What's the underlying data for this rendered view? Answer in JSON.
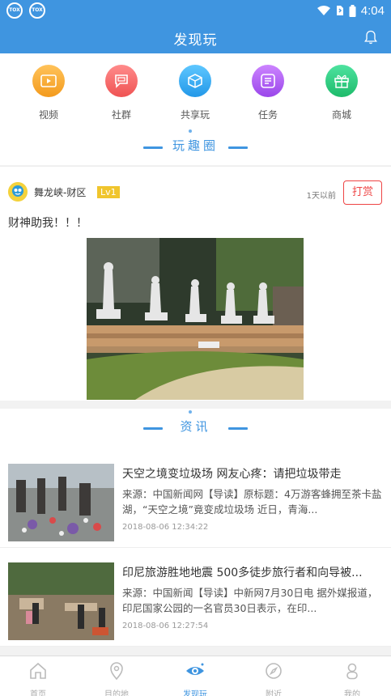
{
  "status_bar": {
    "left_badges": [
      "TOX",
      "TOX"
    ],
    "time": "4:04"
  },
  "app_bar": {
    "title": "发现玩",
    "right_icon": "bell-icon"
  },
  "quick_menu": [
    {
      "label": "视频",
      "icon": "video-icon",
      "color": "#f6a623"
    },
    {
      "label": "社群",
      "icon": "chat-icon",
      "color": "#f56b6b"
    },
    {
      "label": "共享玩",
      "icon": "box-icon",
      "color": "#34a8ef"
    },
    {
      "label": "任务",
      "icon": "task-icon",
      "color": "#b057ef"
    },
    {
      "label": "商城",
      "icon": "gift-icon",
      "color": "#28d07e"
    }
  ],
  "sections": {
    "fun_circle": "玩趣圈",
    "news": "资讯"
  },
  "post": {
    "username": "舞龙峡-财区",
    "level": "Lv1",
    "time_ago": "1天以前",
    "tip_label": "打赏",
    "content": "财神助我！！！"
  },
  "news": [
    {
      "title": "天空之境变垃圾场 网友心疼：请把垃圾带走",
      "summary": "来源：中国新闻网【导读】原标题：4万游客蜂拥至茶卡盐湖，“天空之境”竟变成垃圾场 近日，青海...",
      "date": "2018-08-06 12:34:22"
    },
    {
      "title": "印尼旅游胜地地震 500多徒步旅行者和向导被...",
      "summary": "来源：中国新闻【导读】中新网7月30日电 据外媒报道，印尼国家公园的一名官员30日表示，在印...",
      "date": "2018-08-06 12:27:54"
    }
  ],
  "tab_bar": [
    {
      "label": "首页",
      "icon": "home-icon",
      "active": false
    },
    {
      "label": "目的地",
      "icon": "location-icon",
      "active": false
    },
    {
      "label": "发现玩",
      "icon": "eye-icon",
      "active": true
    },
    {
      "label": "附近",
      "icon": "compass-icon",
      "active": false
    },
    {
      "label": "我的",
      "icon": "user-icon",
      "active": false
    }
  ],
  "colors": {
    "primary": "#3f95e0",
    "tip": "#e44444",
    "level": "#f0c52d"
  }
}
